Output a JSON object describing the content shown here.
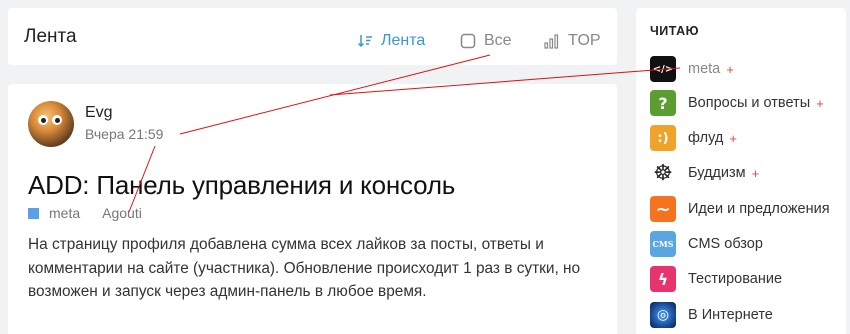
{
  "header": {
    "title": "Лента",
    "tabs": [
      {
        "label": "Лента",
        "icon": "sort-icon",
        "active": true
      },
      {
        "label": "Все",
        "icon": "checkbox-icon",
        "active": false
      },
      {
        "label": "TOP",
        "icon": "bars-icon",
        "active": false
      }
    ]
  },
  "post": {
    "author": "Evg",
    "time": "Вчера 21:59",
    "title": "ADD: Панель управления и консоль",
    "category": "meta",
    "tag": "Agouti",
    "body": "На страницу профиля добавлена сумма всех лайков за посты, ответы и комментарии на сайте (участника). Обновление происходит 1 раз в сутки, но возможен и запуск через админ-панель в любое время."
  },
  "sidebar": {
    "title": "ЧИТАЮ",
    "items": [
      {
        "label": "meta",
        "plus": "+",
        "icon": "code-icon",
        "color": "#111111",
        "glyph": "</>"
      },
      {
        "label": "Вопросы и ответы",
        "plus": "+",
        "icon": "question-icon",
        "color": "#5a9e2f",
        "glyph": "?"
      },
      {
        "label": "флуд",
        "plus": "+",
        "icon": "smile-icon",
        "color": "#f0a32a",
        "glyph": ":)"
      },
      {
        "label": "Буддизм",
        "plus": "+",
        "icon": "dharma-wheel-icon",
        "color": "#ffffff",
        "glyph": "☸"
      },
      {
        "label": "Идеи и предложения",
        "plus": "",
        "icon": "wave-icon",
        "color": "#f5731f",
        "glyph": "~"
      },
      {
        "label": "CMS обзор",
        "plus": "",
        "icon": "cms-icon",
        "color": "#5aa6e0",
        "glyph": "CMS"
      },
      {
        "label": "Тестирование",
        "plus": "",
        "icon": "lightning-icon",
        "color": "#e8346e",
        "glyph": "ϟ"
      },
      {
        "label": "В Интернете",
        "plus": "",
        "icon": "globe-icon",
        "color": "#1b4f9c",
        "glyph": "◎"
      }
    ]
  }
}
